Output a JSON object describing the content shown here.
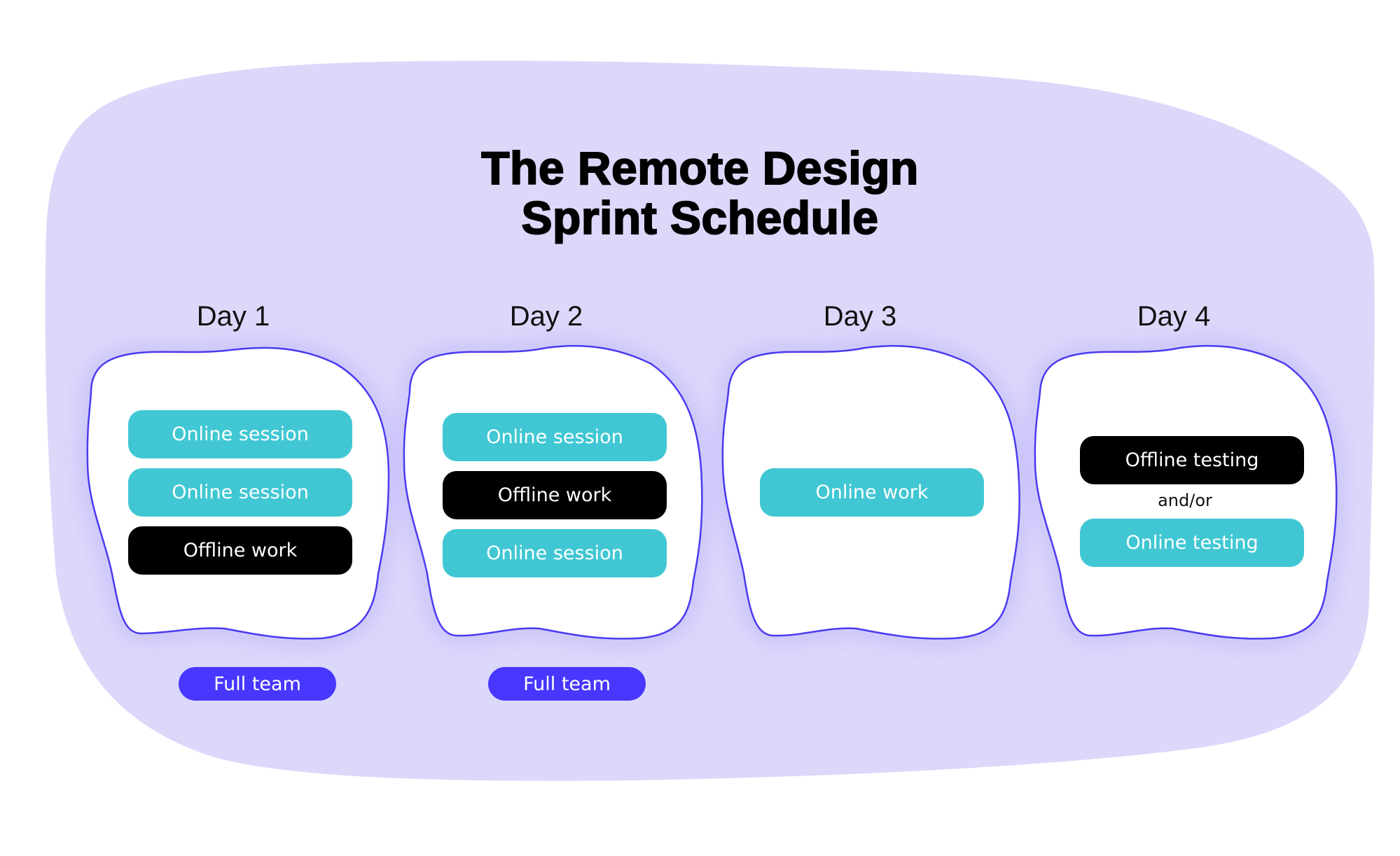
{
  "title": {
    "line1": "The Remote Design",
    "line2": "Sprint Schedule"
  },
  "colors": {
    "background_blob": "#dcd8fa",
    "card_outline": "#4a3af0",
    "online": "#40c7d3",
    "offline": "#000000",
    "full_team_pill": "#4737ff"
  },
  "days": [
    {
      "label": "Day 1",
      "items": [
        {
          "label": "Online session",
          "type": "online"
        },
        {
          "label": "Online session",
          "type": "online"
        },
        {
          "label": "Offline work",
          "type": "offline"
        }
      ],
      "badge": "Full team"
    },
    {
      "label": "Day 2",
      "items": [
        {
          "label": "Online session",
          "type": "online"
        },
        {
          "label": "Offline work",
          "type": "offline"
        },
        {
          "label": "Online session",
          "type": "online"
        }
      ],
      "badge": "Full team"
    },
    {
      "label": "Day 3",
      "items": [
        {
          "label": "Online work",
          "type": "online"
        }
      ]
    },
    {
      "label": "Day 4",
      "items": [
        {
          "label": "Offline testing",
          "type": "offline"
        },
        {
          "label": "Online testing",
          "type": "online"
        }
      ],
      "connector": "and/or"
    }
  ]
}
